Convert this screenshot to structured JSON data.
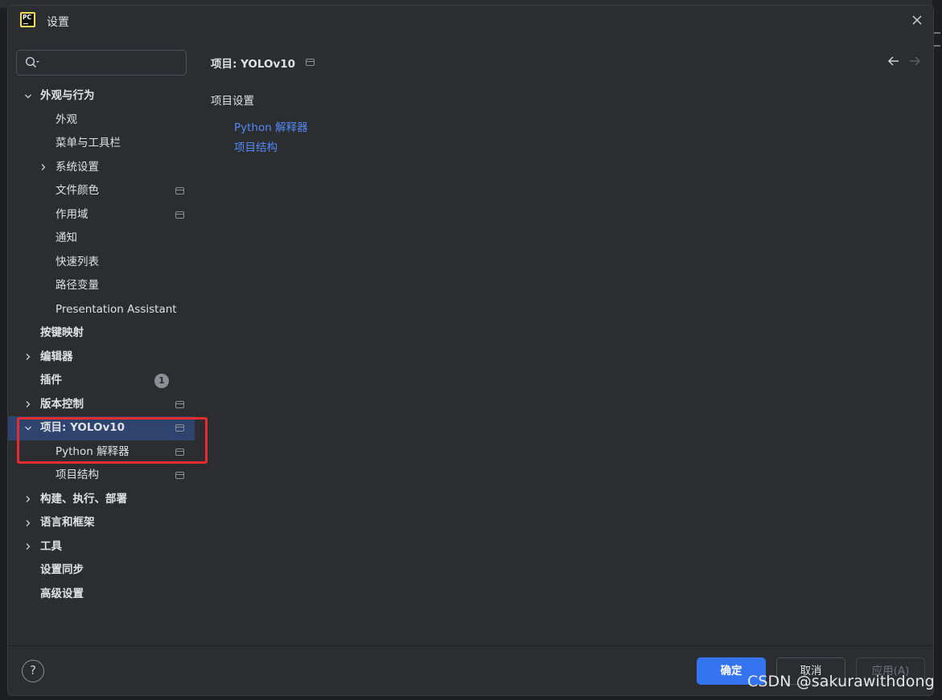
{
  "window": {
    "title": "设置",
    "app_logo_text": "PC"
  },
  "sidebar": {
    "search": {
      "value": "",
      "placeholder": ""
    },
    "items": [
      {
        "label": "外观与行为",
        "level": 0,
        "expandable": true,
        "expanded": true
      },
      {
        "label": "外观",
        "level": 1
      },
      {
        "label": "菜单与工具栏",
        "level": 1
      },
      {
        "label": "系统设置",
        "level": 1,
        "expandable": true,
        "expanded": false
      },
      {
        "label": "文件颜色",
        "level": 1,
        "project_icon": true
      },
      {
        "label": "作用域",
        "level": 1,
        "project_icon": true
      },
      {
        "label": "通知",
        "level": 1
      },
      {
        "label": "快速列表",
        "level": 1
      },
      {
        "label": "路径变量",
        "level": 1
      },
      {
        "label": "Presentation Assistant",
        "level": 1
      },
      {
        "label": "按键映射",
        "level": 0
      },
      {
        "label": "编辑器",
        "level": 0,
        "expandable": true,
        "expanded": false
      },
      {
        "label": "插件",
        "level": 0,
        "badge": "1"
      },
      {
        "label": "版本控制",
        "level": 0,
        "expandable": true,
        "expanded": false,
        "project_icon": true
      },
      {
        "label": "项目: YOLOv10",
        "level": 0,
        "expandable": true,
        "expanded": true,
        "project_icon": true,
        "selected": true
      },
      {
        "label": "Python 解释器",
        "level": 1,
        "project_icon": true
      },
      {
        "label": "项目结构",
        "level": 1,
        "project_icon": true
      },
      {
        "label": "构建、执行、部署",
        "level": 0,
        "expandable": true,
        "expanded": false
      },
      {
        "label": "语言和框架",
        "level": 0,
        "expandable": true,
        "expanded": false
      },
      {
        "label": "工具",
        "level": 0,
        "expandable": true,
        "expanded": false
      },
      {
        "label": "设置同步",
        "level": 0
      },
      {
        "label": "高级设置",
        "level": 0
      }
    ]
  },
  "content": {
    "breadcrumb": "项目: YOLOv10",
    "section_title": "项目设置",
    "links": [
      "Python 解释器",
      "项目结构"
    ]
  },
  "footer": {
    "help": "?",
    "ok_label": "确定",
    "cancel_label": "取消",
    "apply_label": "应用(A)"
  },
  "watermark": "CSDN @sakurawithdong",
  "colors": {
    "accent": "#3574f0",
    "link": "#548af7",
    "selection": "#2e436e",
    "highlight_box": "#e62c2c",
    "background": "#2b2d30"
  }
}
